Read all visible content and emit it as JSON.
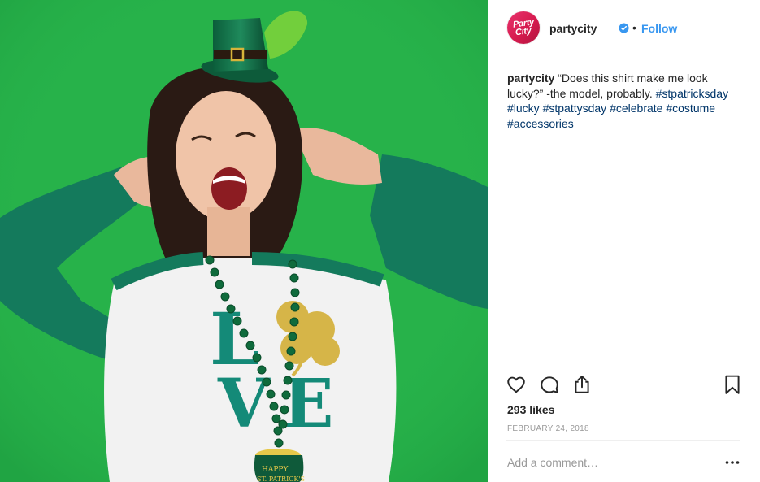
{
  "post": {
    "username": "partycity",
    "follow_label": "Follow",
    "dot": "•",
    "avatar_text": [
      "Party",
      "City"
    ],
    "caption": {
      "username": "partycity",
      "text": " “Does this shirt make me look lucky?” -the model, probably. ",
      "hashtags": [
        "#stpatricksday",
        "#lucky",
        "#stpattysday",
        "#celebrate",
        "#costume",
        "#accessories"
      ]
    },
    "likes": "293 likes",
    "date": "FEBRUARY 24, 2018",
    "comment_placeholder": "Add a comment…"
  },
  "photo": {
    "shirt_letters": [
      "L",
      "V",
      "E"
    ],
    "medallion_text": [
      "HAPPY",
      "ST. PATRICK'S"
    ]
  },
  "icons": {
    "like": "heart-icon",
    "comment": "comment-bubble-icon",
    "share": "share-icon",
    "save": "bookmark-icon",
    "more": "ellipsis-icon",
    "verified": "verified-badge-icon"
  },
  "colors": {
    "background_green": "#27b24a",
    "link_blue": "#3897f0",
    "hashtag": "#003569",
    "brand_red": "#e8336d"
  }
}
